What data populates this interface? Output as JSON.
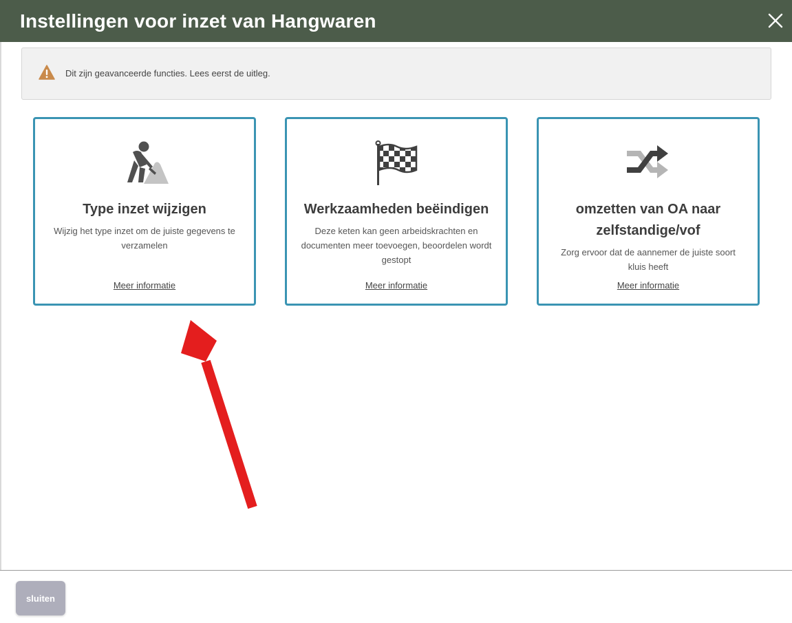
{
  "modal": {
    "title": "Instellingen voor inzet van Hangwaren"
  },
  "alert": {
    "icon": "warning-icon",
    "text": "Dit zijn geavanceerde functies. Lees eerst de uitleg."
  },
  "cards": [
    {
      "icon": "road-worker-icon",
      "title": "Type inzet wijzigen",
      "description": "Wijzig het type inzet om de juiste gegevens te verzamelen",
      "link": "Meer informatie"
    },
    {
      "icon": "checkered-flag-icon",
      "title": "Werkzaamheden beëindigen",
      "description": "Deze keten kan geen arbeidskrachten en documenten meer toevoegen, beoordelen wordt gestopt",
      "link": "Meer informatie"
    },
    {
      "icon": "shuffle-arrows-icon",
      "title": "omzetten van OA naar zelfstandige/vof",
      "description": "Zorg ervoor dat de aannemer de juiste soort kluis heeft",
      "link": "Meer informatie"
    }
  ],
  "footer": {
    "close_label": "sluiten"
  },
  "colors": {
    "header_bg": "#4c5c4a",
    "card_border": "#3a94b3",
    "warning": "#c98a4b",
    "annotation_arrow": "#e41e1e",
    "footer_button": "#aeaebb"
  }
}
